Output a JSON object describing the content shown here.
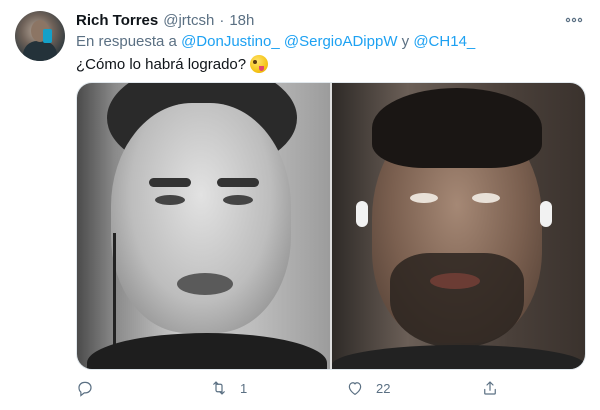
{
  "tweet": {
    "author_name": "Rich Torres",
    "author_handle": "@jrtcsh",
    "separator": "·",
    "time": "18h",
    "reply_prefix": "En respuesta a",
    "mention_1": "@DonJustino_",
    "mention_2": "@SergioADippW",
    "conjunction": "y",
    "mention_3": "@CH14_",
    "text": "¿Cómo lo habrá logrado?",
    "emoji_name": "zany-face-emoji"
  },
  "actions": {
    "reply_count": "",
    "retweet_count": "1",
    "like_count": "22",
    "share_count": ""
  },
  "colors": {
    "link": "#1da1f2",
    "secondary_text": "#5b7083",
    "primary_text": "#0f1419"
  }
}
